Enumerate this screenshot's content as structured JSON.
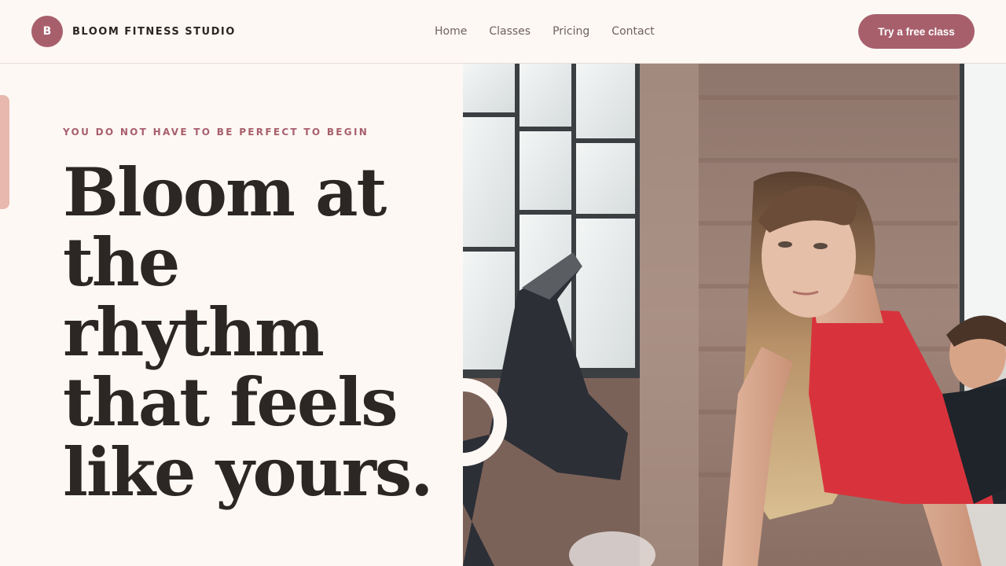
{
  "brand": {
    "mark": "B",
    "name": "BLOOM FITNESS STUDIO",
    "color": "#a85f6c"
  },
  "nav": {
    "items": [
      "Home",
      "Classes",
      "Pricing",
      "Contact"
    ]
  },
  "cta": {
    "label": "Try a free class"
  },
  "hero": {
    "eyebrow": "YOU DO NOT HAVE TO BE PERFECT TO BEGIN",
    "headline": "Bloom at the rhythm that feels like yours.",
    "photo": "woman-in-red-tank-top-exercising-in-gym",
    "accent_color": "#e8b8ae"
  }
}
